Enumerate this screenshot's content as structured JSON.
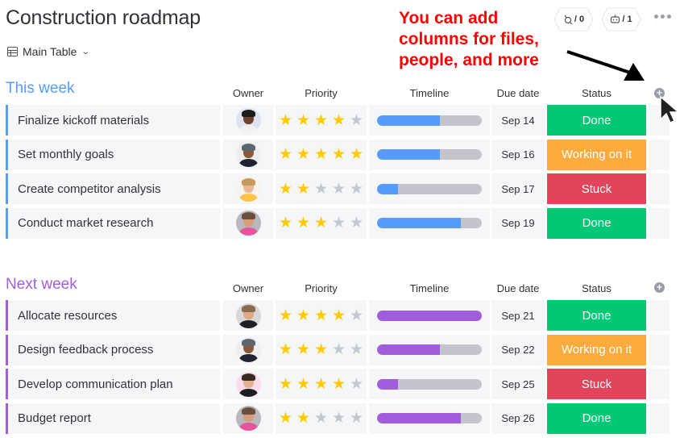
{
  "header": {
    "title": "Construction roadmap",
    "view": {
      "label": "Main Table",
      "icon": "table-icon",
      "chevron": "chevron-down-icon"
    },
    "integrations": {
      "icon": "integrations-icon",
      "count": "/ 0"
    },
    "automations": {
      "icon": "robot-icon",
      "count": "/ 1"
    },
    "more_icon": "more-dots-icon"
  },
  "annotation": {
    "lines": [
      "You can add",
      "columns for files,",
      "people, and more"
    ],
    "color": "#ff0000"
  },
  "columns": {
    "owner": "Owner",
    "priority": "Priority",
    "timeline": "Timeline",
    "due": "Due date",
    "status": "Status",
    "add_icon": "plus-circle-icon"
  },
  "status_colors": {
    "Done": "#00c875",
    "Working on it": "#fdab3d",
    "Stuck": "#e2445c"
  },
  "groups": [
    {
      "title": "This week",
      "color": "#579bfc",
      "rows": [
        {
          "name": "Finalize kickoff materials",
          "owner": "avatar-woman-dark-hair",
          "priority": 4,
          "timeline_progress": 0.6,
          "due": "Sep 14",
          "status": "Done"
        },
        {
          "name": "Set monthly goals",
          "owner": "avatar-man-cap",
          "priority": 5,
          "timeline_progress": 0.6,
          "due": "Sep 16",
          "status": "Working on it"
        },
        {
          "name": "Create competitor analysis",
          "owner": "avatar-woman-blonde",
          "priority": 2,
          "timeline_progress": 0.2,
          "due": "Sep 17",
          "status": "Stuck"
        },
        {
          "name": "Conduct market research",
          "owner": "avatar-man-beard",
          "priority": 3,
          "timeline_progress": 0.8,
          "due": "Sep 19",
          "status": "Done"
        }
      ]
    },
    {
      "title": "Next week",
      "color": "#a25ddc",
      "rows": [
        {
          "name": "Allocate resources",
          "owner": "avatar-man-short-hair",
          "priority": 4,
          "timeline_progress": 1.0,
          "due": "Sep 21",
          "status": "Done"
        },
        {
          "name": "Design feedback process",
          "owner": "avatar-man-cap",
          "priority": 3,
          "timeline_progress": 0.6,
          "due": "Sep 22",
          "status": "Working on it"
        },
        {
          "name": "Develop communication plan",
          "owner": "avatar-woman-brunette",
          "priority": 4,
          "timeline_progress": 0.2,
          "due": "Sep 25",
          "status": "Stuck"
        },
        {
          "name": "Budget report",
          "owner": "avatar-man-beard",
          "priority": 2,
          "timeline_progress": 0.8,
          "due": "Sep 26",
          "status": "Done"
        }
      ]
    }
  ]
}
